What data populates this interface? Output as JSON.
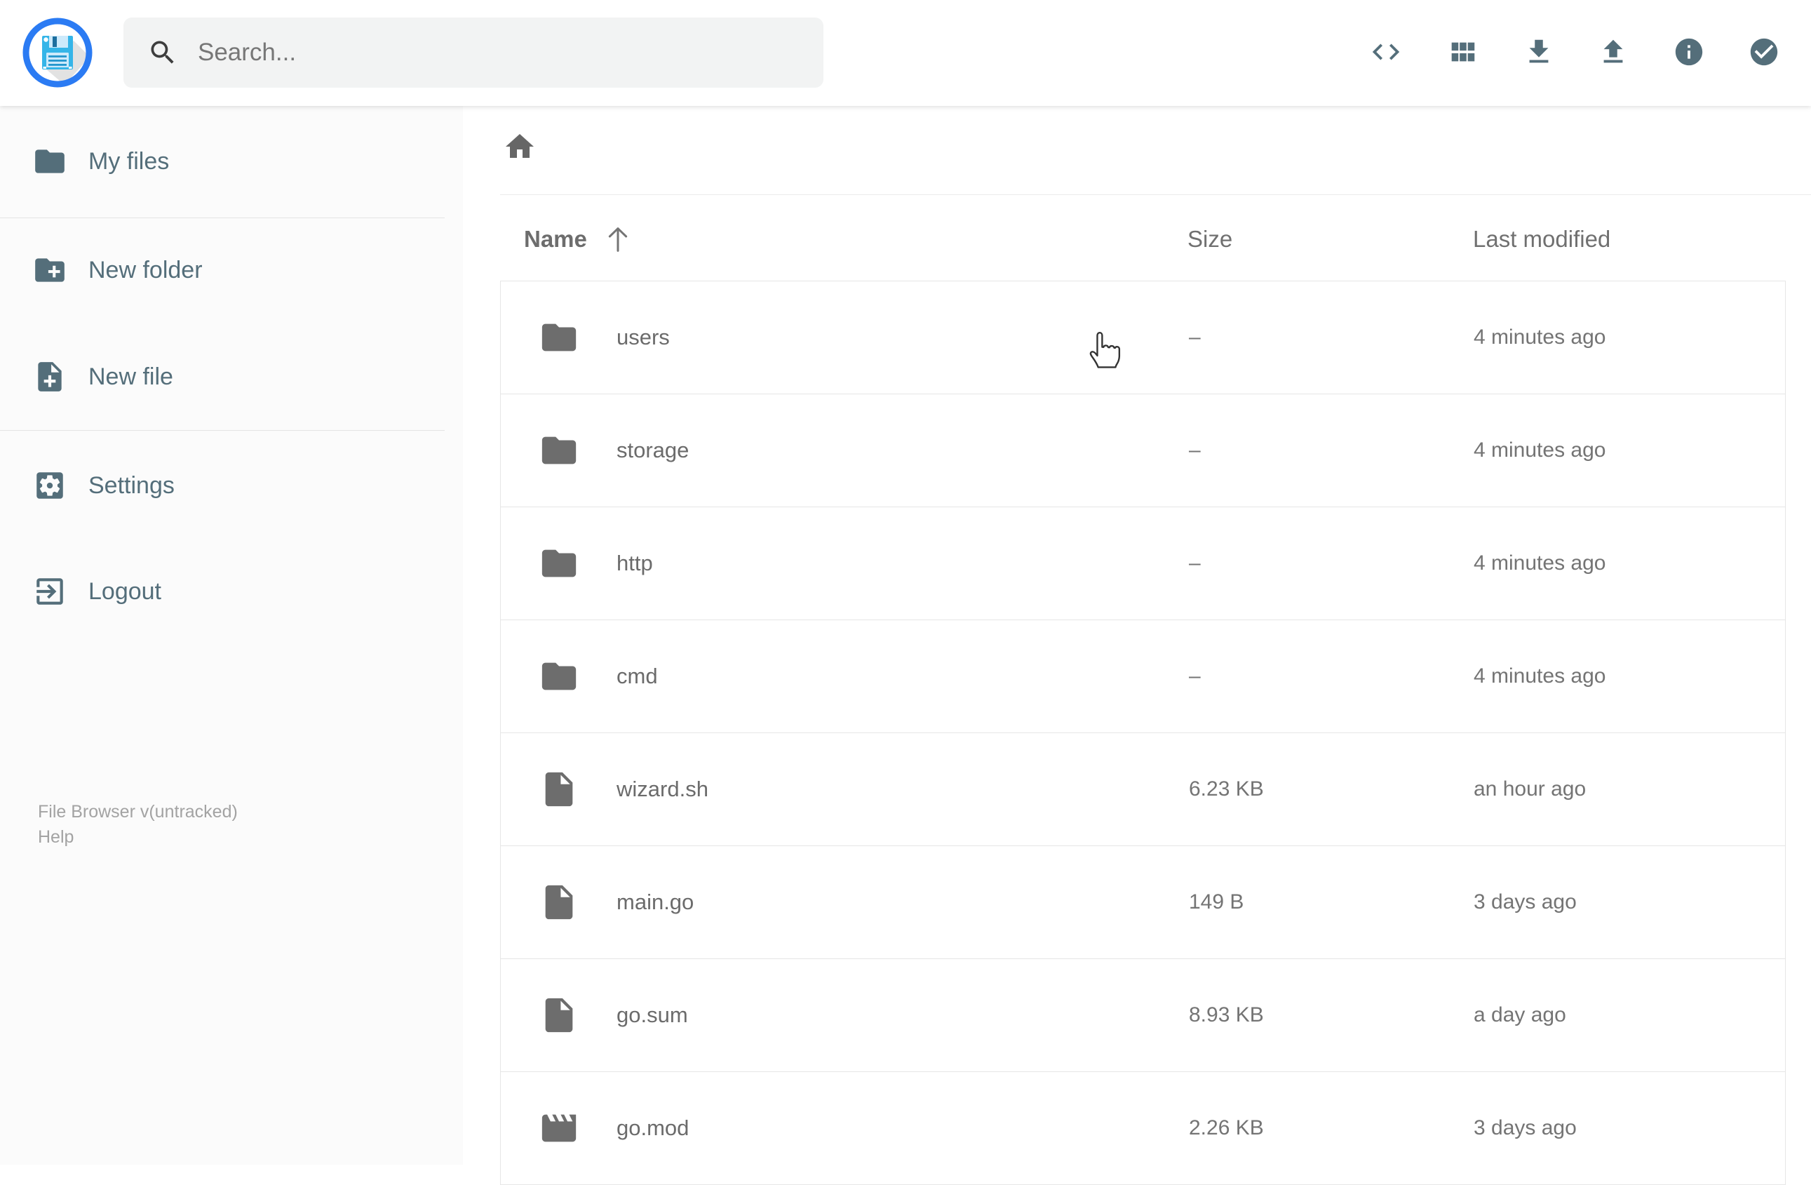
{
  "app": {
    "name": "File Browser"
  },
  "header": {
    "search": {
      "placeholder": "Search..."
    },
    "toolbar_icons": [
      "code-view-icon",
      "grid-view-icon",
      "download-icon",
      "upload-icon",
      "info-icon",
      "select-multiple-icon"
    ]
  },
  "sidebar": {
    "items": [
      {
        "label": "My files",
        "icon": "folder-icon"
      },
      {
        "label": "New folder",
        "icon": "new-folder-icon"
      },
      {
        "label": "New file",
        "icon": "new-file-icon"
      },
      {
        "label": "Settings",
        "icon": "settings-icon"
      },
      {
        "label": "Logout",
        "icon": "logout-icon"
      }
    ],
    "footer": {
      "version": "File Browser v(untracked)",
      "help": "Help"
    }
  },
  "listing": {
    "breadcrumb": {
      "icon": "home-icon"
    },
    "sort": {
      "column": "Name",
      "direction": "ascending"
    },
    "columns": {
      "name": "Name",
      "size": "Size",
      "modified": "Last modified"
    },
    "rows": [
      {
        "icon": "folder",
        "name": "users",
        "size": "–",
        "modified": "4 minutes ago"
      },
      {
        "icon": "folder",
        "name": "storage",
        "size": "–",
        "modified": "4 minutes ago"
      },
      {
        "icon": "folder",
        "name": "http",
        "size": "–",
        "modified": "4 minutes ago"
      },
      {
        "icon": "folder",
        "name": "cmd",
        "size": "–",
        "modified": "4 minutes ago"
      },
      {
        "icon": "file",
        "name": "wizard.sh",
        "size": "6.23 KB",
        "modified": "an hour ago"
      },
      {
        "icon": "file",
        "name": "main.go",
        "size": "149 B",
        "modified": "3 days ago"
      },
      {
        "icon": "file",
        "name": "go.sum",
        "size": "8.93 KB",
        "modified": "a day ago"
      },
      {
        "icon": "movie",
        "name": "go.mod",
        "size": "2.26 KB",
        "modified": "3 days ago"
      }
    ]
  },
  "colors": {
    "accent_blue": "#2b7bf3",
    "slate": "#546e7a",
    "logo_cyan": "#35b5e8"
  }
}
